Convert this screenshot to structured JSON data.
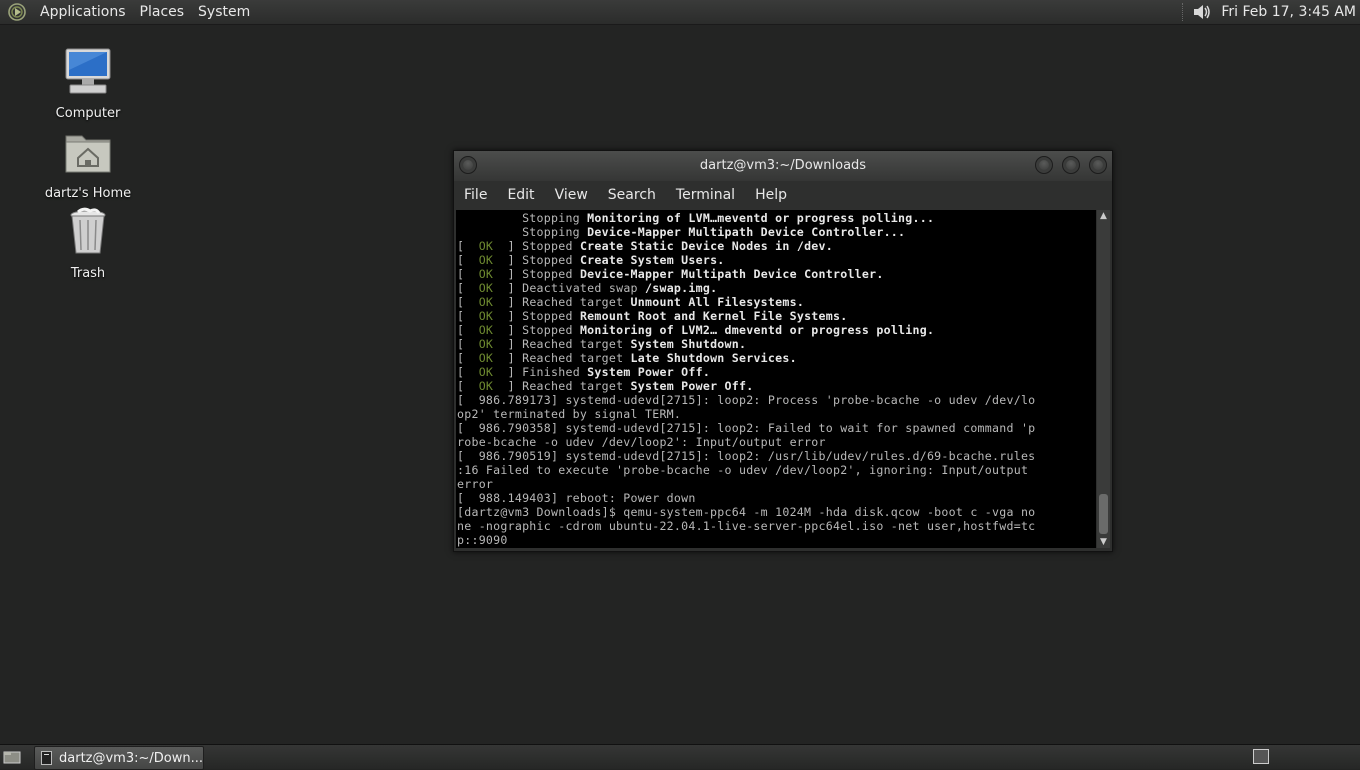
{
  "top_panel": {
    "menus": [
      "Applications",
      "Places",
      "System"
    ],
    "clock": "Fri Feb 17,  3:45 AM"
  },
  "desktop": {
    "icons": [
      {
        "label": "Computer"
      },
      {
        "label": "dartz's Home"
      },
      {
        "label": "Trash"
      }
    ]
  },
  "terminal": {
    "title": "dartz@vm3:~/Downloads",
    "menus": [
      "File",
      "Edit",
      "View",
      "Search",
      "Terminal",
      "Help"
    ],
    "lines": [
      {
        "prefix": "",
        "text": "         Stopping ",
        "bold": "Monitoring of LVM…meventd or progress polling..."
      },
      {
        "prefix": "",
        "text": "         Stopping ",
        "bold": "Device-Mapper Multipath Device Controller..."
      },
      {
        "prefix": "ok",
        "text": "Stopped ",
        "bold": "Create Static Device Nodes in /dev."
      },
      {
        "prefix": "ok",
        "text": "Stopped ",
        "bold": "Create System Users."
      },
      {
        "prefix": "ok",
        "text": "Stopped ",
        "bold": "Device-Mapper Multipath Device Controller."
      },
      {
        "prefix": "ok",
        "text": "Deactivated swap ",
        "bold": "/swap.img."
      },
      {
        "prefix": "ok",
        "text": "Reached target ",
        "bold": "Unmount All Filesystems."
      },
      {
        "prefix": "ok",
        "text": "Stopped ",
        "bold": "Remount Root and Kernel File Systems."
      },
      {
        "prefix": "ok",
        "text": "Stopped ",
        "bold": "Monitoring of LVM2… dmeventd or progress polling."
      },
      {
        "prefix": "ok",
        "text": "Reached target ",
        "bold": "System Shutdown."
      },
      {
        "prefix": "ok",
        "text": "Reached target ",
        "bold": "Late Shutdown Services."
      },
      {
        "prefix": "ok",
        "text": "Finished ",
        "bold": "System Power Off."
      },
      {
        "prefix": "ok",
        "text": "Reached target ",
        "bold": "System Power Off."
      },
      {
        "prefix": "",
        "text": "[  986.789173] systemd-udevd[2715]: loop2: Process 'probe-bcache -o udev /dev/lo",
        "bold": ""
      },
      {
        "prefix": "",
        "text": "op2' terminated by signal TERM.",
        "bold": ""
      },
      {
        "prefix": "",
        "text": "[  986.790358] systemd-udevd[2715]: loop2: Failed to wait for spawned command 'p",
        "bold": ""
      },
      {
        "prefix": "",
        "text": "robe-bcache -o udev /dev/loop2': Input/output error",
        "bold": ""
      },
      {
        "prefix": "",
        "text": "[  986.790519] systemd-udevd[2715]: loop2: /usr/lib/udev/rules.d/69-bcache.rules",
        "bold": ""
      },
      {
        "prefix": "",
        "text": ":16 Failed to execute 'probe-bcache -o udev /dev/loop2', ignoring: Input/output",
        "bold": ""
      },
      {
        "prefix": "",
        "text": "error",
        "bold": ""
      },
      {
        "prefix": "",
        "text": "[  988.149403] reboot: Power down",
        "bold": ""
      },
      {
        "prefix": "",
        "text": "[dartz@vm3 Downloads]$ qemu-system-ppc64 -m 1024M -hda disk.qcow -boot c -vga no",
        "bold": ""
      },
      {
        "prefix": "",
        "text": "ne -nographic -cdrom ubuntu-22.04.1-live-server-ppc64el.iso -net user,hostfwd=tc",
        "bold": ""
      },
      {
        "prefix": "",
        "text": "p::9090",
        "bold": ""
      }
    ]
  },
  "taskbar": {
    "task_label": "dartz@vm3:~/Down..."
  },
  "colors": {
    "desktop_bg": "#232423",
    "terminal_bg": "#000000",
    "ok_green": "#6e8a30"
  }
}
